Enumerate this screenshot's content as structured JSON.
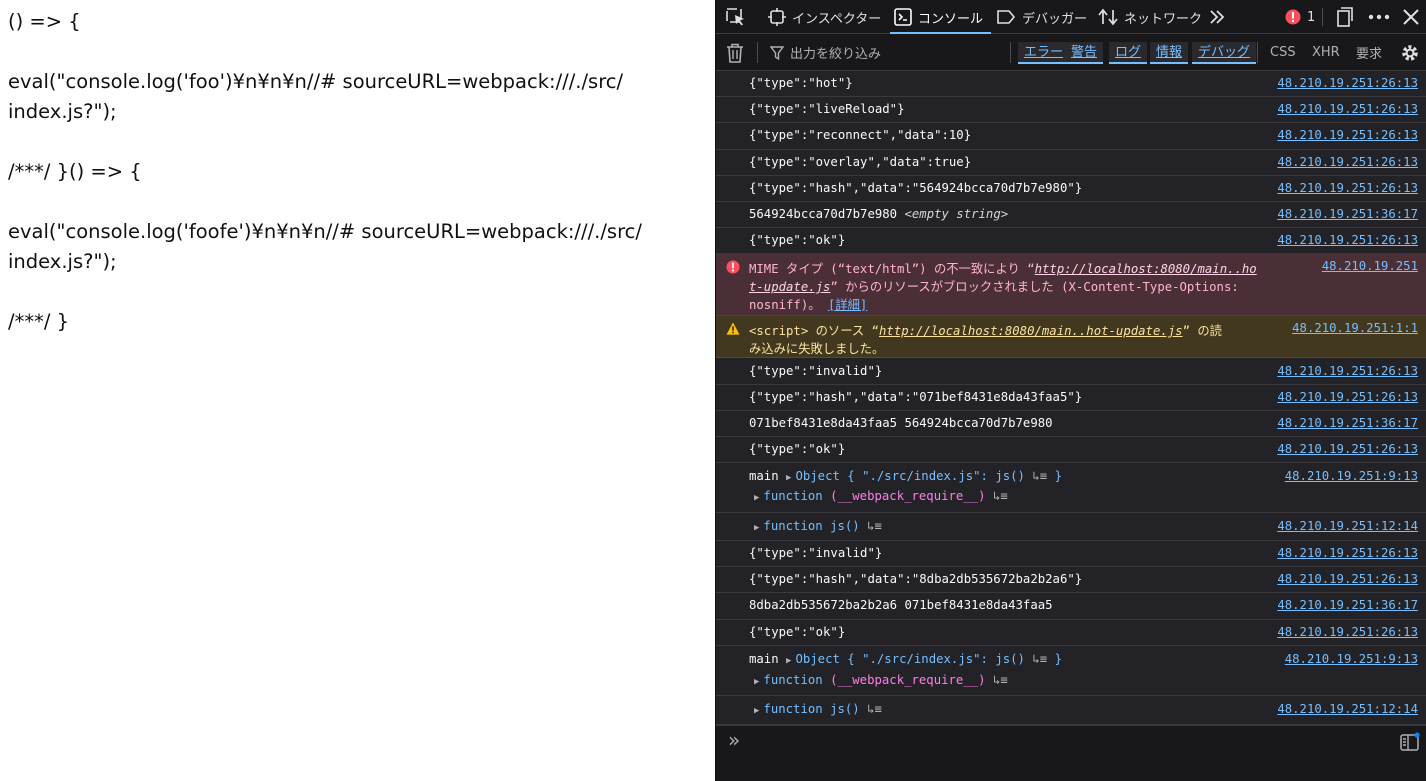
{
  "page": {
    "lines": [
      "() => {",
      "eval(\"console.log('foo')¥n¥n¥n//# sourceURL=webpack:///./src/",
      "index.js?\");",
      "/***/ }() => {",
      "eval(\"console.log('foofe')¥n¥n¥n//# sourceURL=webpack:///./src/",
      "index.js?\");",
      "/***/ }"
    ]
  },
  "devtools": {
    "tabs": {
      "inspector": "インスペクター",
      "console": "コンソール",
      "debugger": "デバッガー",
      "network": "ネットワーク"
    },
    "error_count": "1",
    "filter": {
      "placeholder": "出力を絞り込み",
      "levels": [
        "エラー",
        "警告",
        "ログ",
        "情報",
        "デバッグ"
      ],
      "extra": [
        "CSS",
        "XHR",
        "要求"
      ]
    },
    "colors": {
      "accent": "#75bfff",
      "error_bg": "#4b2f36",
      "warning_bg": "#42381f",
      "panel_bg": "#232327"
    },
    "rows": [
      {
        "msg": "{\"type\":\"hot\"}",
        "src": "48.210.19.251:26:13"
      },
      {
        "msg": "{\"type\":\"liveReload\"}",
        "src": "48.210.19.251:26:13"
      },
      {
        "msg": "{\"type\":\"reconnect\",\"data\":10}",
        "src": "48.210.19.251:26:13"
      },
      {
        "msg": "{\"type\":\"overlay\",\"data\":true}",
        "src": "48.210.19.251:26:13"
      },
      {
        "msg": "{\"type\":\"hash\",\"data\":\"564924bcca70d7b7e980\"}",
        "src": "48.210.19.251:26:13"
      },
      {
        "msg": "564924bcca70d7b7e980",
        "msg_italic": "<empty string>",
        "src": "48.210.19.251:36:17"
      },
      {
        "msg": "{\"type\":\"ok\"}",
        "src": "48.210.19.251:26:13"
      }
    ],
    "error": {
      "pre": "MIME タイプ (“text/html”) の不一致により “",
      "link_a": "http://localhost:8080/main..ho",
      "link_b": "t-update.js",
      "post": "” からのリソースがブロックされました (X-Content-Type-Options:",
      "line3": "nosniff)。",
      "detail": "[詳細]",
      "src": "48.210.19.251"
    },
    "warning": {
      "pre": "<script> のソース “",
      "link": "http://localhost:8080/main..hot-update.js",
      "post": "” の読",
      "line2": "み込みに失敗しました。",
      "src": "48.210.19.251:1:1"
    },
    "rows2": [
      {
        "msg": "{\"type\":\"invalid\"}",
        "src": "48.210.19.251:26:13"
      },
      {
        "msg": "{\"type\":\"hash\",\"data\":\"071bef8431e8da43faa5\"}",
        "src": "48.210.19.251:26:13"
      },
      {
        "msg": "071bef8431e8da43faa5 564924bcca70d7b7e980",
        "src": "48.210.19.251:36:17"
      },
      {
        "msg": "{\"type\":\"ok\"}",
        "src": "48.210.19.251:26:13"
      }
    ],
    "obj1": {
      "label": "main",
      "object": "Object { \"./src/index.js\": js()",
      "close": "}",
      "func": "function",
      "func_name": "(__webpack_require__)",
      "src": "48.210.19.251:9:13"
    },
    "fn1": {
      "func": "function",
      "name": "js()",
      "src": "48.210.19.251:12:14"
    },
    "rows3": [
      {
        "msg": "{\"type\":\"invalid\"}",
        "src": "48.210.19.251:26:13"
      },
      {
        "msg": "{\"type\":\"hash\",\"data\":\"8dba2db535672ba2b2a6\"}",
        "src": "48.210.19.251:26:13"
      },
      {
        "msg": "8dba2db535672ba2b2a6 071bef8431e8da43faa5",
        "src": "48.210.19.251:36:17"
      },
      {
        "msg": "{\"type\":\"ok\"}",
        "src": "48.210.19.251:26:13"
      }
    ],
    "obj2": {
      "label": "main",
      "object": "Object { \"./src/index.js\": js()",
      "close": "}",
      "func": "function",
      "func_name": "(__webpack_require__)",
      "src": "48.210.19.251:9:13"
    },
    "fn2": {
      "func": "function",
      "name": "js()",
      "src": "48.210.19.251:12:14"
    },
    "prompt": "»"
  }
}
